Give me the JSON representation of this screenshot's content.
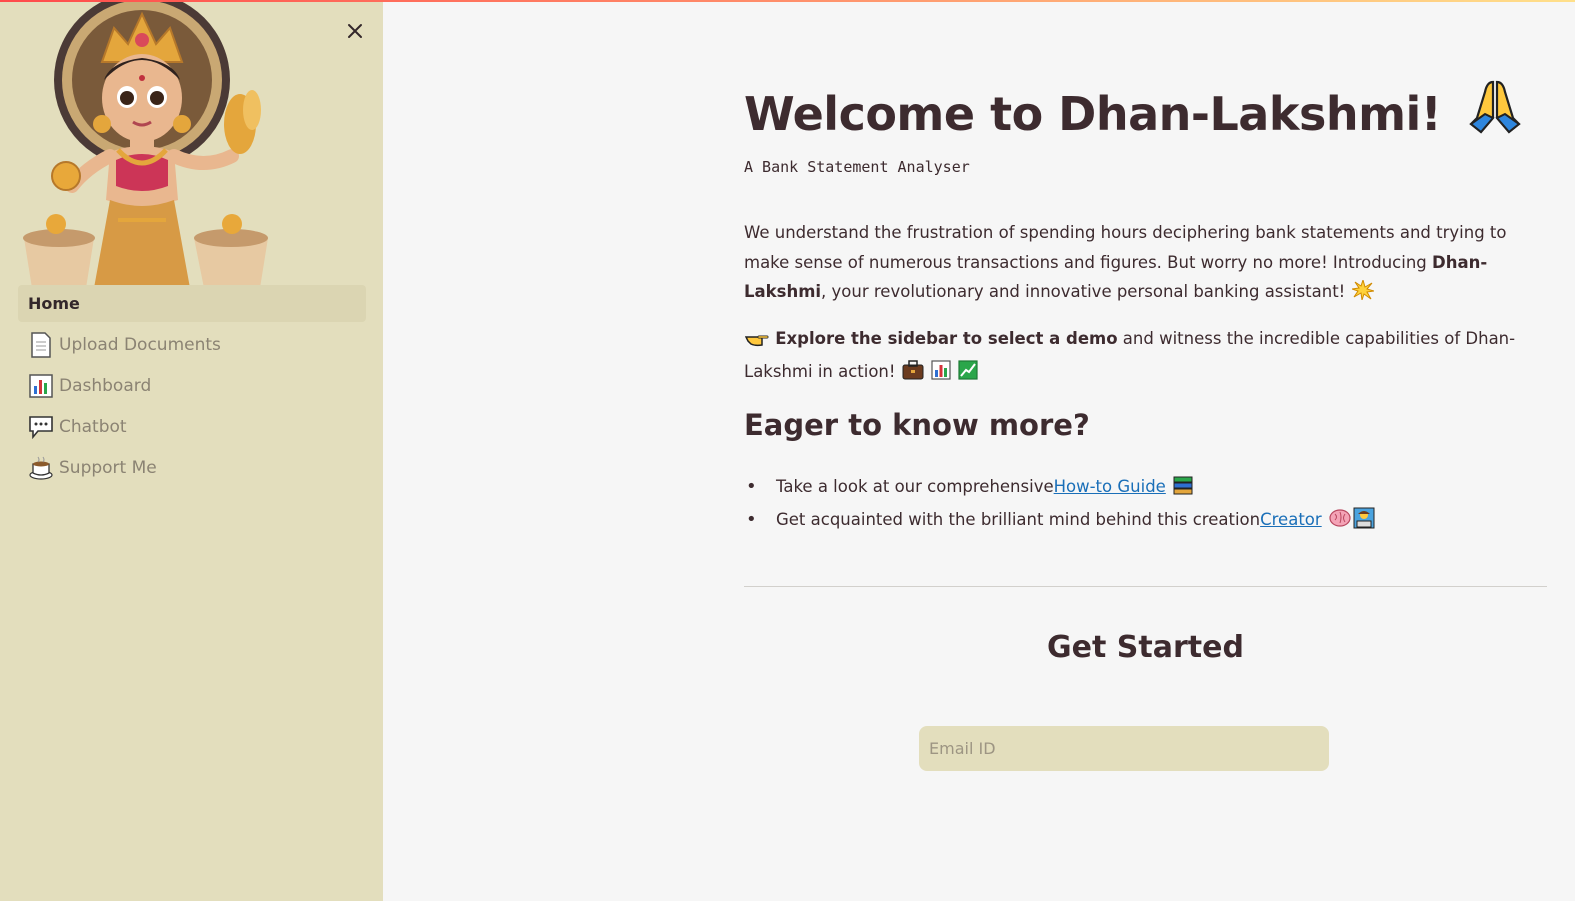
{
  "app": {
    "accent_gradient": [
      "#ff4b4b",
      "#ff8f6b",
      "#ffe08a"
    ],
    "sidebar_bg": "#e3debd",
    "main_bg": "#f6f6f6",
    "text_color": "#3d2b2f",
    "link_color": "#1a6fb8"
  },
  "sidebar": {
    "close_icon": "close-icon",
    "logo": "dhan-lakshmi-goddess-illustration",
    "items": [
      {
        "label": "Home",
        "active": true,
        "icon": ""
      },
      {
        "label": "Upload Documents",
        "active": false,
        "icon": "page-icon"
      },
      {
        "label": "Dashboard",
        "active": false,
        "icon": "bar-chart-icon"
      },
      {
        "label": "Chatbot",
        "active": false,
        "icon": "speech-bubble-icon"
      },
      {
        "label": "Support Me",
        "active": false,
        "icon": "coffee-cup-icon"
      }
    ]
  },
  "main": {
    "title": "Welcome to Dhan-Lakshmi!",
    "title_icon": "folded-hands-icon",
    "subtitle": "A Bank Statement Analyser",
    "intro_part1": "We understand the frustration of spending hours deciphering bank statements and trying to make sense of numerous transactions and figures. But worry no more! Introducing ",
    "intro_bold": "Dhan-Lakshmi",
    "intro_part2": ", your revolutionary and innovative personal banking assistant!",
    "intro_icon": "sparkle-icon",
    "explore_bold": "Explore the sidebar to select a demo",
    "explore_rest": " and witness the incredible capabilities of Dhan-Lakshmi in action!",
    "explore_icons": [
      "pointing-hand-icon",
      "briefcase-icon",
      "bar-chart-icon",
      "trend-up-icon"
    ],
    "section_heading": "Eager to know more?",
    "bullets": [
      {
        "text": "Take a look at our comprehensive ",
        "link": "How-to Guide",
        "icons": [
          "books-icon"
        ]
      },
      {
        "text": "Get acquainted with the brilliant mind behind this creation ",
        "link": "Creator",
        "icons": [
          "brain-icon",
          "technologist-icon"
        ]
      }
    ],
    "get_started": "Get Started",
    "email_placeholder": "Email ID"
  }
}
